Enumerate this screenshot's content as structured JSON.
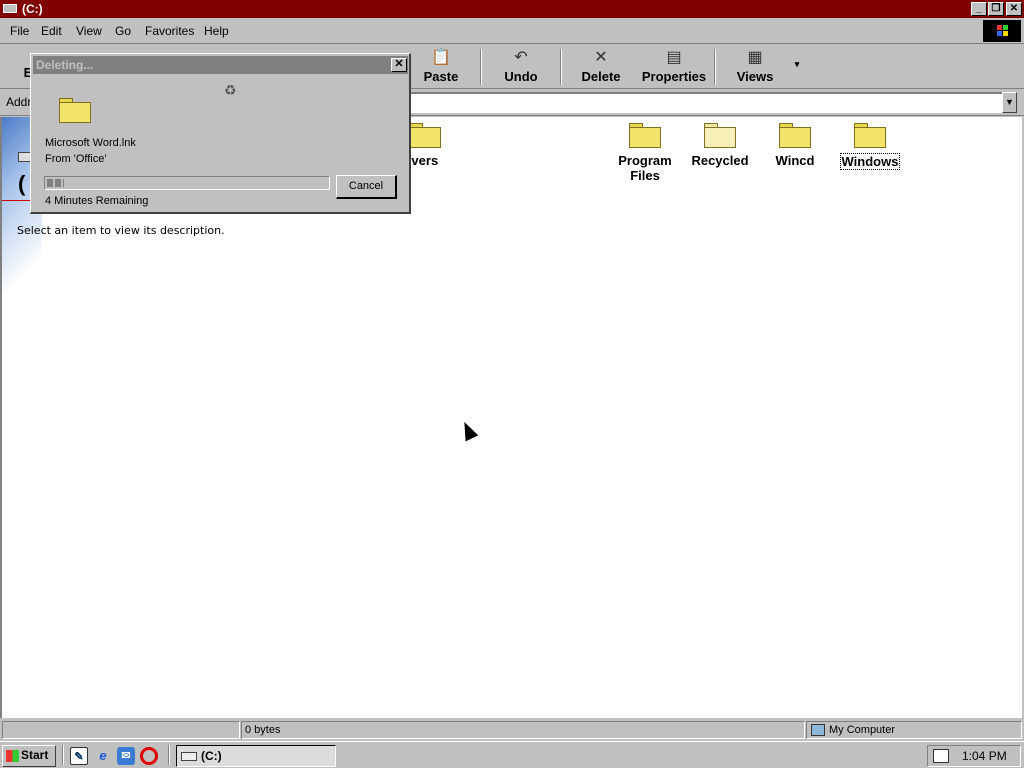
{
  "window": {
    "title": "(C:)"
  },
  "menu": {
    "file": "File",
    "edit": "Edit",
    "view": "View",
    "go": "Go",
    "favorites": "Favorites",
    "help": "Help"
  },
  "toolbar": {
    "partial_left": "E",
    "paste": "Paste",
    "undo": "Undo",
    "delete": "Delete",
    "properties": "Properties",
    "views": "Views"
  },
  "address": {
    "label": "Addr",
    "value": ""
  },
  "content": {
    "partial_title": "(",
    "description": "Select an item to view its description.",
    "partial_folder_label": "ivers",
    "folders": [
      {
        "name": "Program Files",
        "line1": "Program",
        "line2": "Files"
      },
      {
        "name": "Recycled",
        "line1": "Recycled",
        "line2": ""
      },
      {
        "name": "Wincd",
        "line1": "Wincd",
        "line2": ""
      },
      {
        "name": "Windows",
        "line1": "Windows",
        "line2": "",
        "selected": true
      }
    ]
  },
  "dialog": {
    "title": "Deleting...",
    "file": "Microsoft Word.lnk",
    "from": "From 'Office'",
    "progress": 0.06,
    "remaining": "4 Minutes Remaining",
    "cancel": "Cancel"
  },
  "status": {
    "size": "0 bytes",
    "zone": "My Computer"
  },
  "taskbar": {
    "start": "Start",
    "task": "(C:)",
    "clock": "1:04 PM"
  },
  "colors": {
    "titlebar": "#800000",
    "dialog_titlebar_inactive": "#808080",
    "face": "#c0c0c0"
  }
}
